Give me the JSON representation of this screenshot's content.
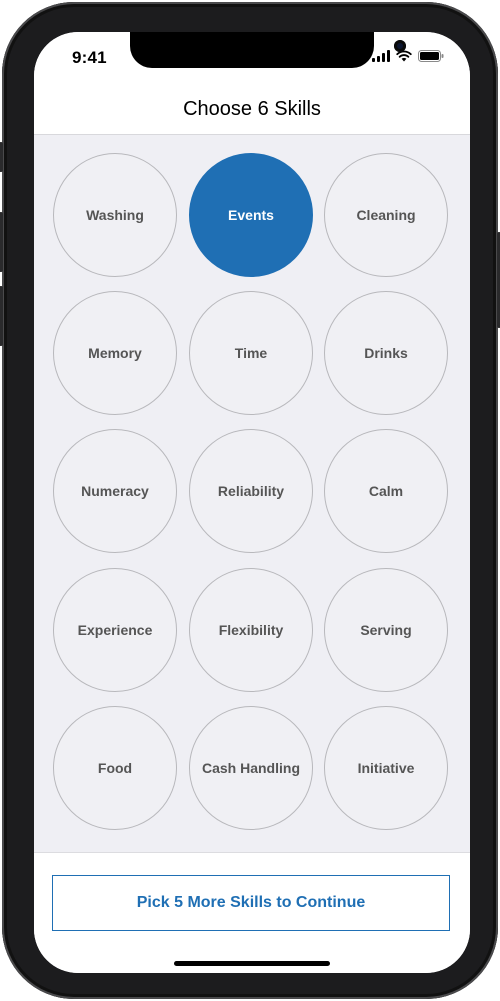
{
  "status_bar": {
    "time": "9:41",
    "icons": [
      "signal-icon",
      "wifi-icon",
      "battery-icon"
    ]
  },
  "header": {
    "title": "Choose 6 Skills"
  },
  "skills": [
    {
      "label": "Washing",
      "selected": false
    },
    {
      "label": "Events",
      "selected": true
    },
    {
      "label": "Cleaning",
      "selected": false
    },
    {
      "label": "Memory",
      "selected": false
    },
    {
      "label": "Time",
      "selected": false
    },
    {
      "label": "Drinks",
      "selected": false
    },
    {
      "label": "Numeracy",
      "selected": false
    },
    {
      "label": "Reliability",
      "selected": false
    },
    {
      "label": "Calm",
      "selected": false
    },
    {
      "label": "Experience",
      "selected": false
    },
    {
      "label": "Flexibility",
      "selected": false
    },
    {
      "label": "Serving",
      "selected": false
    },
    {
      "label": "Food",
      "selected": false
    },
    {
      "label": "Cash Handling",
      "selected": false
    },
    {
      "label": "Initiative",
      "selected": false
    }
  ],
  "footer": {
    "continue_label": "Pick 5 More Skills to Continue"
  },
  "colors": {
    "accent": "#1f6fb4",
    "background": "#efeff4"
  }
}
